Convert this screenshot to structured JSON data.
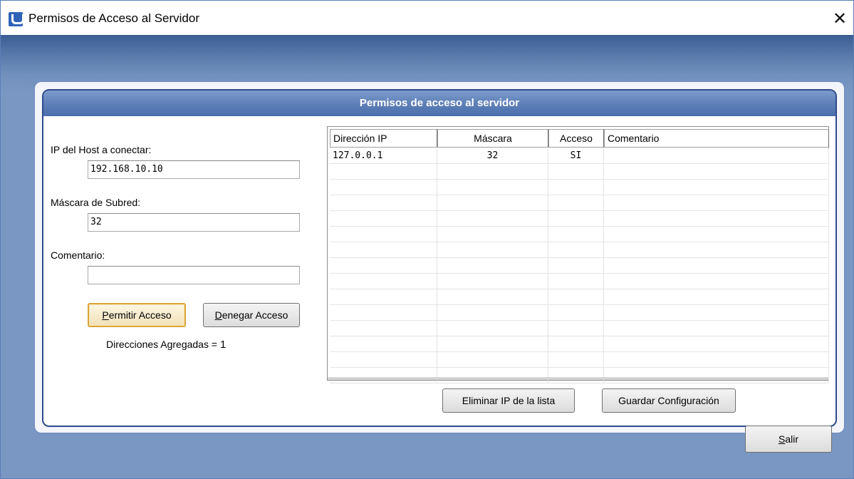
{
  "window": {
    "title": "Permisos de Acceso al Servidor",
    "close_glyph": "✕"
  },
  "panel": {
    "header": "Permisos de acceso al servidor"
  },
  "form": {
    "host_label": "IP del Host a conectar:",
    "host_value": "192.168.10.10",
    "mask_label": "Máscara de Subred:",
    "mask_value": "32",
    "comment_label": "Comentario:",
    "comment_value": "",
    "allow_button_prefix": "P",
    "allow_button_rest": "ermitir Acceso",
    "deny_button_prefix": "D",
    "deny_button_rest": "enegar Acceso",
    "added_count_text": "Direcciones Agregadas = ",
    "added_count": "1"
  },
  "table": {
    "columns": [
      "Dirección IP",
      "Máscara",
      "Acceso",
      "Comentario"
    ],
    "rows": [
      {
        "ip": "127.0.0.1",
        "mask": "32",
        "access": "SI",
        "comment": ""
      }
    ]
  },
  "actions": {
    "remove_ip": "Eliminar IP de la lista",
    "save_config": "Guardar Configuración",
    "exit_prefix": "S",
    "exit_rest": "alir"
  },
  "colors": {
    "accent": "#2d4a8d",
    "header": "#5f80b8",
    "background": "#7a96c2",
    "focus": "#d9a53a"
  },
  "icons": {
    "app": "app-logo-icon",
    "close": "close-icon"
  }
}
